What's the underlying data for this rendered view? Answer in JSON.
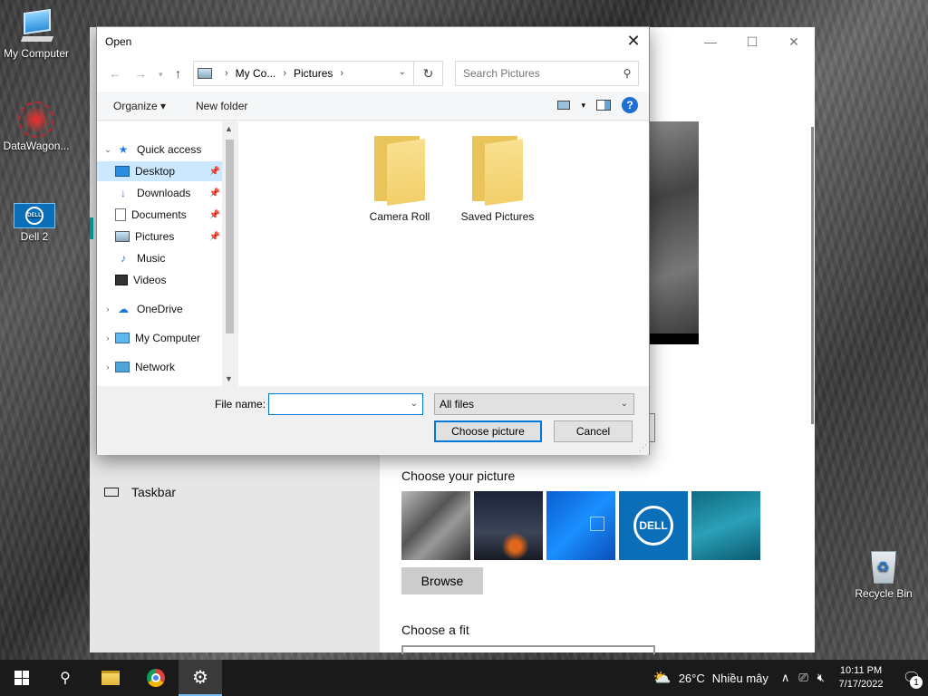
{
  "desktop": {
    "icons": [
      {
        "label": "My Computer"
      },
      {
        "label": "DataWagon..."
      },
      {
        "label": "Dell 2"
      },
      {
        "label": "Recycle Bin"
      }
    ]
  },
  "settings": {
    "sidebar_taskbar_label": "Taskbar",
    "choose_picture_label": "Choose your picture",
    "browse_label": "Browse",
    "choose_fit_label": "Choose a fit",
    "dell_thumb_text": "DELL",
    "window_controls": [
      "—",
      "☐",
      "✕"
    ]
  },
  "dialog": {
    "title": "Open",
    "close_glyph": "✕",
    "breadcrumb": [
      "My Co...",
      "Pictures"
    ],
    "search_placeholder": "Search Pictures",
    "toolbar": {
      "organize_label": "Organize ▾",
      "new_folder_label": "New folder"
    },
    "nav": {
      "quick_access": "Quick access",
      "desktop": "Desktop",
      "downloads": "Downloads",
      "documents": "Documents",
      "pictures": "Pictures",
      "music": "Music",
      "videos": "Videos",
      "onedrive": "OneDrive",
      "my_computer": "My Computer",
      "network": "Network"
    },
    "folders": [
      {
        "name": "Camera Roll"
      },
      {
        "name": "Saved Pictures"
      }
    ],
    "file_name_label": "File name:",
    "file_name_value": "",
    "filter_value": "All files",
    "choose_button": "Choose picture",
    "cancel_button": "Cancel"
  },
  "taskbar": {
    "weather_temp": "26°C",
    "weather_text": "Nhiều mây",
    "time": "10:11 PM",
    "date": "7/17/2022",
    "notification_count": "1"
  }
}
